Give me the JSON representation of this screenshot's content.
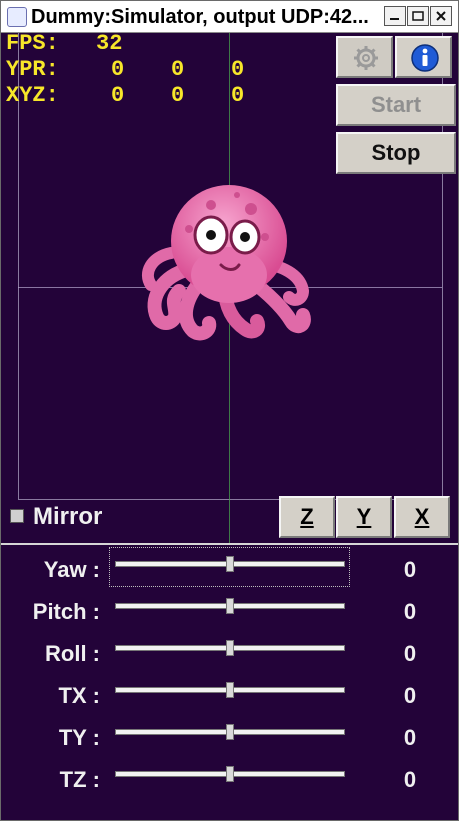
{
  "window": {
    "title": "Dummy:Simulator, output UDP:42..."
  },
  "readouts": {
    "fps": {
      "label": "FPS:",
      "value": "32"
    },
    "ypr": {
      "label": "YPR:",
      "values": [
        "0",
        "0",
        "0"
      ]
    },
    "xyz": {
      "label": "XYZ:",
      "values": [
        "0",
        "0",
        "0"
      ]
    }
  },
  "buttons": {
    "settings_icon": "gear-icon",
    "info_icon": "info-icon",
    "start": "Start",
    "stop": "Stop",
    "mirror": "Mirror",
    "z": "Z",
    "y": "Y",
    "x": "X"
  },
  "sliders": [
    {
      "label": "Yaw :",
      "value": "0",
      "position_fraction": 0.5
    },
    {
      "label": "Pitch :",
      "value": "0",
      "position_fraction": 0.5
    },
    {
      "label": "Roll :",
      "value": "0",
      "position_fraction": 0.5
    },
    {
      "label": "TX :",
      "value": "0",
      "position_fraction": 0.5
    },
    {
      "label": "TY :",
      "value": "0",
      "position_fraction": 0.5
    },
    {
      "label": "TZ :",
      "value": "0",
      "position_fraction": 0.5
    }
  ],
  "colors": {
    "background": "#230339",
    "readout": "#f7e62a",
    "octopus": "#e36aa9"
  }
}
